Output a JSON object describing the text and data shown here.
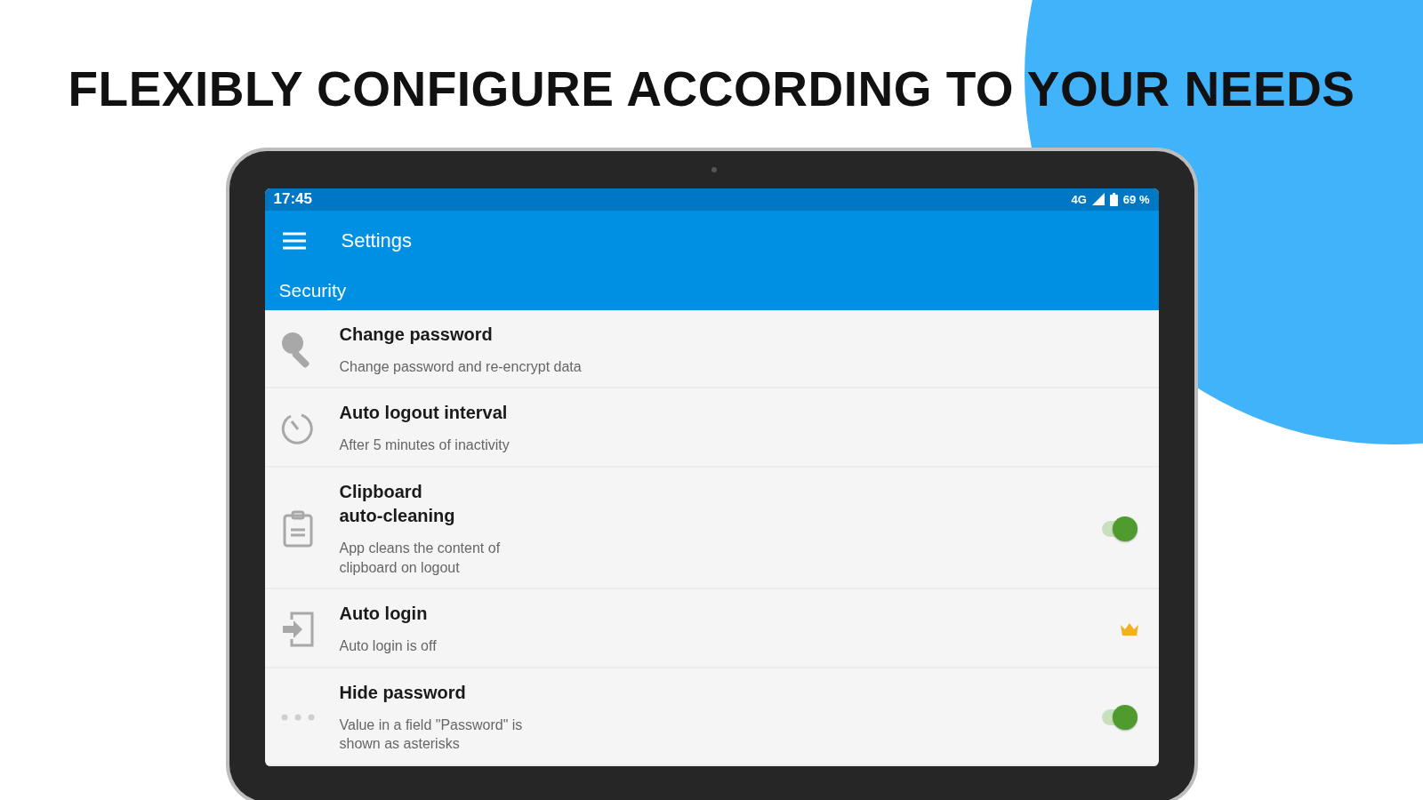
{
  "headline": "FLEXIBLY CONFIGURE ACCORDING TO YOUR NEEDS",
  "status_bar": {
    "time": "17:45",
    "network": "4G",
    "battery": "69 %"
  },
  "app_bar": {
    "title": "Settings"
  },
  "section": {
    "title": "Security"
  },
  "settings": [
    {
      "kind": "plain",
      "title": "Change password",
      "summary": "Change password and re-encrypt data"
    },
    {
      "kind": "plain",
      "title": "Auto logout interval",
      "summary": "After 5 minutes of inactivity"
    },
    {
      "kind": "switch",
      "title": "Clipboard auto-cleaning",
      "summary": "App cleans the content of clipboard on logout",
      "on": true
    },
    {
      "kind": "premium",
      "title": "Auto login",
      "summary": "Auto login is off"
    },
    {
      "kind": "switch",
      "title": "Hide password",
      "summary": "Value in a field \"Password\" is shown as asterisks",
      "on": true
    }
  ]
}
